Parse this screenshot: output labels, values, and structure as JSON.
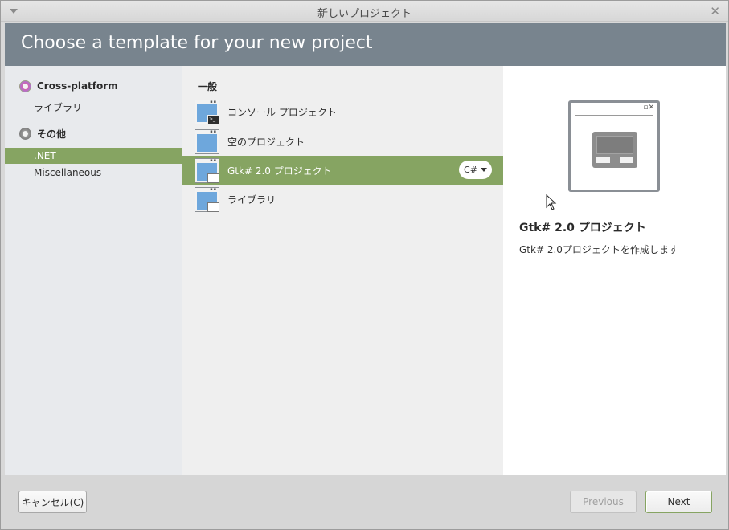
{
  "window": {
    "title": "新しいプロジェクト"
  },
  "header": {
    "title": "Choose a template for your new project"
  },
  "categories": [
    {
      "label": "Cross-platform",
      "items": [
        "ライブラリ"
      ]
    },
    {
      "label": "その他",
      "items": [
        ".NET",
        "Miscellaneous"
      ]
    }
  ],
  "templates": {
    "section": "一般",
    "items": [
      {
        "label": "コンソール プロジェクト"
      },
      {
        "label": "空のプロジェクト"
      },
      {
        "label": "Gtk# 2.0 プロジェクト",
        "language": "C#"
      },
      {
        "label": "ライブラリ"
      }
    ]
  },
  "details": {
    "title": "Gtk# 2.0 プロジェクト",
    "description": "Gtk# 2.0プロジェクトを作成します"
  },
  "footer": {
    "cancel": "キャンセル(C)",
    "previous": "Previous",
    "next": "Next"
  },
  "colors": {
    "accent": "#86a462",
    "header_bg": "#78848e",
    "icon_blue": "#6ea7dc"
  },
  "icons": {
    "menu": "chevron-down-icon",
    "close": "close-icon",
    "cross_platform": "cross-platform-category-icon",
    "other": "other-category-icon",
    "console": "console-project-icon",
    "empty": "empty-project-icon",
    "gtk": "gtk-project-icon",
    "library": "library-project-icon",
    "preview": "gtk-window-preview-icon",
    "cursor": "mouse-pointer-icon"
  }
}
